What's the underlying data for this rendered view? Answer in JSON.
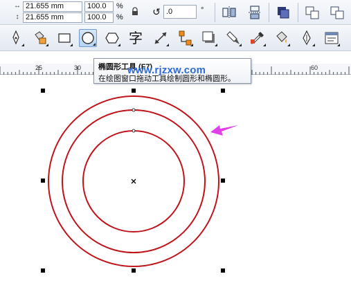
{
  "propbar": {
    "width_value": "21.655 mm",
    "height_value": "21.655 mm",
    "scale_x": "100.0",
    "scale_y": "100.0",
    "percent_x": "%",
    "percent_y": "%",
    "rotation_value": ".0",
    "degree_symbol": "°"
  },
  "toolbox": {
    "active_tool": "ellipse-tool",
    "tools": [
      "pen-tool",
      "smart-fill-tool",
      "rectangle-tool",
      "ellipse-tool",
      "polygon-tool",
      "text-tool",
      "dimension-tool",
      "connector-tool",
      "drop-shadow-tool",
      "transparency-tool",
      "color-eyedropper-tool",
      "fill-tool",
      "outline-pen-tool",
      "object-properties-tool"
    ],
    "text_tool_glyph": "字"
  },
  "ruler": {
    "labels": [
      "25",
      "30",
      "60"
    ]
  },
  "tooltip": {
    "title": "椭圆形工具 (F7)",
    "description": "在绘图窗口拖动工具绘制圆形和椭圆形。",
    "watermark": "www.rjzxw.com"
  },
  "canvas": {
    "circle_color": "#c0141c",
    "arrow_color": "#e040e8",
    "handle_color": "#000000",
    "circle_count": 3
  }
}
